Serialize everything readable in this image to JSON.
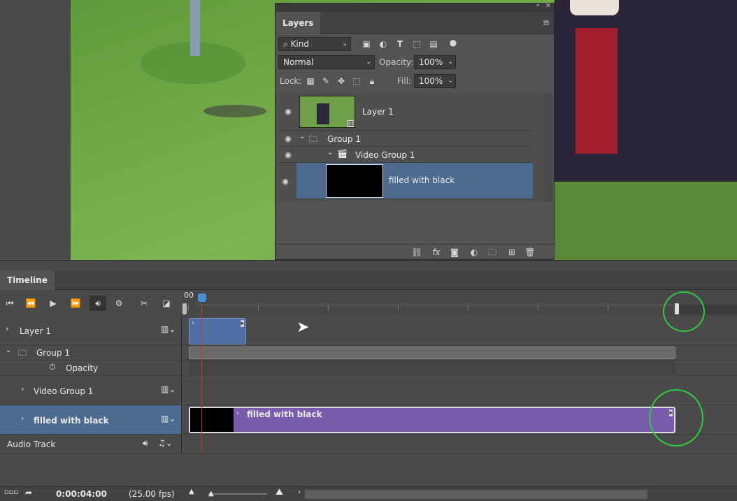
{
  "layers_panel": {
    "title": "Layers",
    "filter_label": "Kind",
    "blend_mode": "Normal",
    "opacity_label": "Opacity:",
    "opacity_value": "100%",
    "lock_label": "Lock:",
    "fill_label": "Fill:",
    "fill_value": "100%",
    "layers": [
      {
        "name": "Layer 1"
      },
      {
        "name": "Group 1"
      },
      {
        "name": "Video Group 1"
      },
      {
        "name": "filled with black"
      }
    ],
    "footer_icons": [
      "link-icon",
      "fx-icon",
      "mask-icon",
      "adjustment-icon",
      "folder-icon",
      "new-layer-icon",
      "trash-icon"
    ]
  },
  "timeline": {
    "title": "Timeline",
    "ruler_start": "00",
    "tracks": [
      {
        "name": "Layer 1"
      },
      {
        "name": "Group 1"
      },
      {
        "name": "Opacity"
      },
      {
        "name": "Video Group 1"
      },
      {
        "name": "filled with black"
      },
      {
        "name": "Audio Track"
      }
    ],
    "clip_label": "filled with black",
    "timecode": "0:00:04:00",
    "fps": "(25.00 fps)"
  },
  "colors": {
    "selection": "#4d6a8f",
    "clip_purple": "#7a5cae",
    "clip_blue": "#4d6fa3",
    "highlight_circle": "#2ecc40",
    "playhead": "#c0392b"
  }
}
